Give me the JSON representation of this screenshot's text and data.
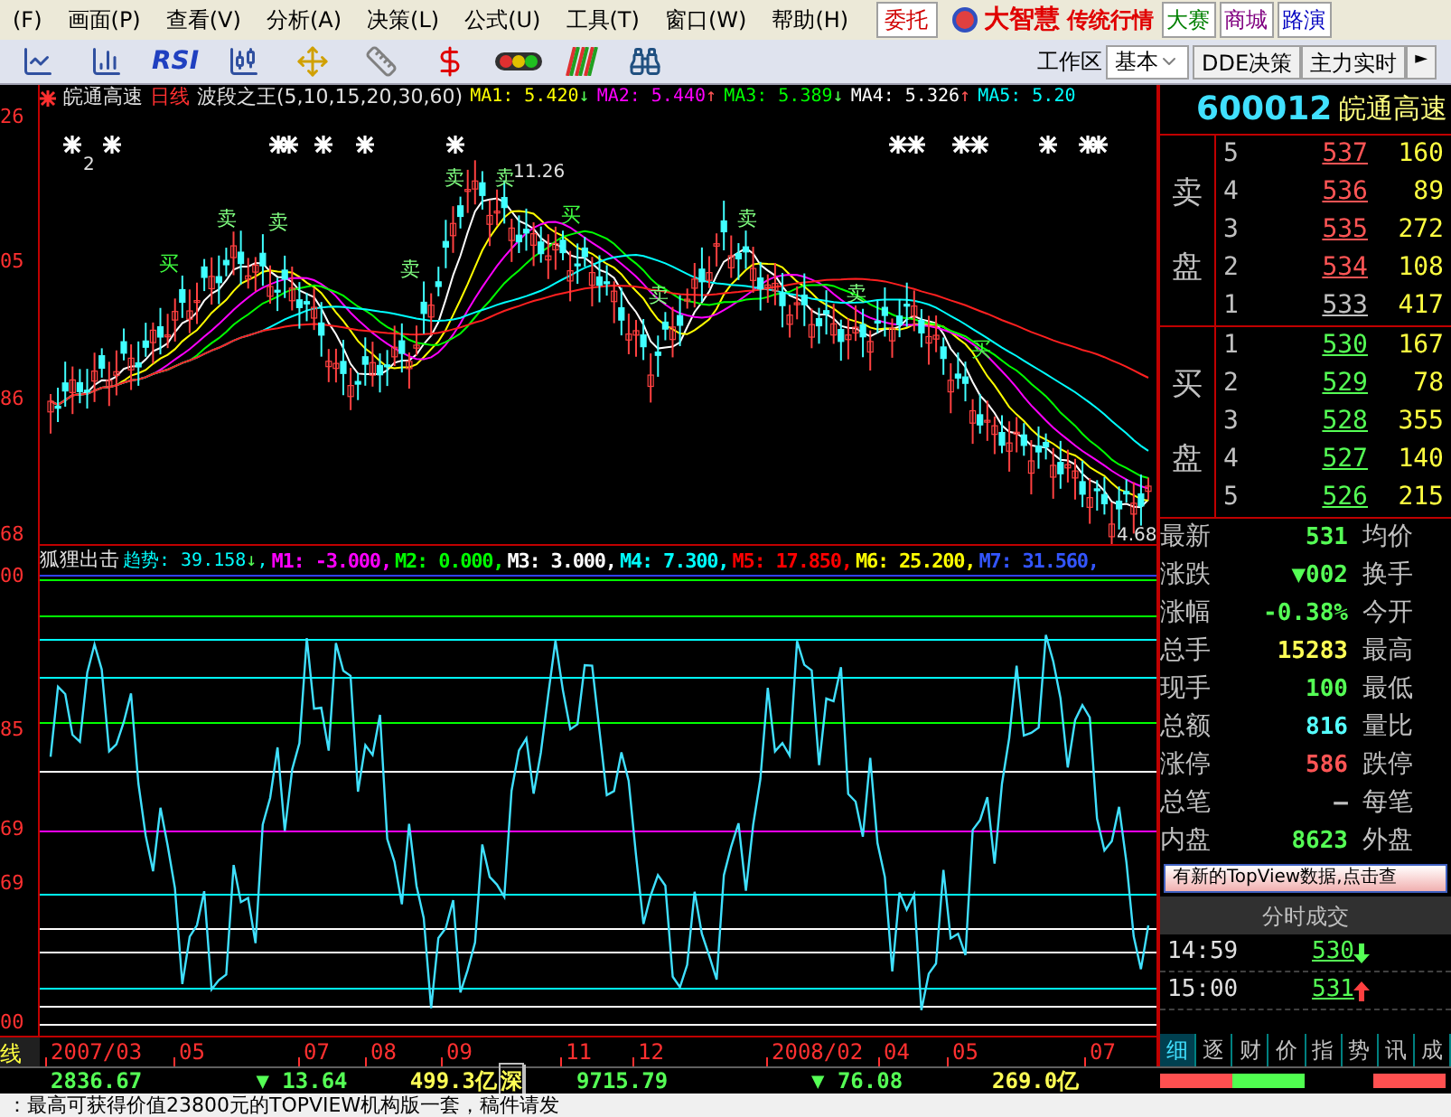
{
  "menu": [
    "(F)",
    "画面(P)",
    "查看(V)",
    "分析(A)",
    "决策(L)",
    "公式(U)",
    "工具(T)",
    "窗口(W)",
    "帮助(H)"
  ],
  "order_button": "委托",
  "brand": {
    "name": "大智慧",
    "subtitle": "传统行情"
  },
  "top_links": [
    "大赛",
    "商城",
    "路演"
  ],
  "toolbar": {
    "rsi": "RSI",
    "workspace_label": "工作区",
    "workspace_value": "基本",
    "tabs": [
      "DDE决策",
      "主力实时"
    ],
    "more": "►"
  },
  "upper_chart": {
    "stock": "皖通高速",
    "period": "日线",
    "indicator": "波段之王(5,10,15,20,30,60)",
    "mas": [
      {
        "label": "MA1: 5.420",
        "arrow": "↓",
        "rising": false,
        "color": "#ffff00"
      },
      {
        "label": "MA2: 5.440",
        "arrow": "↑",
        "rising": true,
        "color": "#ff00ff"
      },
      {
        "label": "MA3: 5.389",
        "arrow": "↓",
        "rising": false,
        "color": "#00ff00"
      },
      {
        "label": "MA4: 5.326",
        "arrow": "↑",
        "rising": true,
        "color": "#ffffff"
      },
      {
        "label": "MA5: 5.20",
        "color": "#00ffff"
      }
    ],
    "axis": [
      "26",
      "05",
      "86",
      "68"
    ],
    "annotations": [
      "11.26",
      "2",
      "4.68"
    ],
    "signals": [
      {
        "text": "买",
        "kind": "buy"
      },
      {
        "text": "卖",
        "kind": "sell"
      },
      {
        "text": "卖",
        "kind": "sell"
      },
      {
        "text": "卖",
        "kind": "sell"
      },
      {
        "text": "卖",
        "kind": "sell"
      },
      {
        "text": "卖",
        "kind": "sell"
      },
      {
        "text": "买",
        "kind": "buy"
      },
      {
        "text": "卖",
        "kind": "sell"
      },
      {
        "text": "卖",
        "kind": "sell"
      },
      {
        "text": "卖",
        "kind": "sell"
      },
      {
        "text": "买",
        "kind": "buy"
      }
    ]
  },
  "lower_chart": {
    "name": "狐狸出击",
    "trend": {
      "label": "趋势: 39.158",
      "arrow": "↓",
      "rising": false,
      "separator": ","
    },
    "lines": [
      {
        "label": "M1: -3.000,",
        "color": "#ff00ff"
      },
      {
        "label": "M2: 0.000,",
        "color": "#00ff00"
      },
      {
        "label": "M3: 3.000,",
        "color": "#ffffff"
      },
      {
        "label": "M4: 7.300,",
        "color": "#00ffff"
      },
      {
        "label": "M5: 17.850,",
        "color": "#ff0000"
      },
      {
        "label": "M6: 25.200,",
        "color": "#ffff00"
      },
      {
        "label": "M7: 31.560,",
        "color": "#3355ff"
      }
    ],
    "axis": [
      "00",
      "85",
      "69",
      "69",
      "00"
    ]
  },
  "time_axis": {
    "label": "线",
    "ticks": [
      "2007/03",
      "05",
      "07",
      "08",
      "09",
      "11",
      "12",
      "2008/02",
      "04",
      "05",
      "07"
    ]
  },
  "quote": {
    "code": "600012",
    "name": "皖通高速",
    "sell_label": "卖盘",
    "buy_label": "买盘",
    "sell": [
      {
        "rank": "5",
        "price": "537",
        "volume": "160",
        "color": "#ff5555"
      },
      {
        "rank": "4",
        "price": "536",
        "volume": "89",
        "color": "#ff5555"
      },
      {
        "rank": "3",
        "price": "535",
        "volume": "272",
        "color": "#ff5555"
      },
      {
        "rank": "2",
        "price": "534",
        "volume": "108",
        "color": "#ff5555"
      },
      {
        "rank": "1",
        "price": "533",
        "volume": "417",
        "color": "#c0c0c0"
      }
    ],
    "buy": [
      {
        "rank": "1",
        "price": "530",
        "volume": "167",
        "color": "#55ff55"
      },
      {
        "rank": "2",
        "price": "529",
        "volume": "78",
        "color": "#55ff55"
      },
      {
        "rank": "3",
        "price": "528",
        "volume": "355",
        "color": "#55ff55"
      },
      {
        "rank": "4",
        "price": "527",
        "volume": "140",
        "color": "#55ff55"
      },
      {
        "rank": "5",
        "price": "526",
        "volume": "215",
        "color": "#55ff55"
      }
    ],
    "stats": [
      {
        "label": "最新",
        "value": "531",
        "color": "#55ff55",
        "label2": "均价"
      },
      {
        "label": "涨跌",
        "value": "▼002",
        "color": "#55ff55",
        "label2": "换手"
      },
      {
        "label": "涨幅",
        "value": "-0.38%",
        "color": "#55ff55",
        "label2": "今开"
      },
      {
        "label": "总手",
        "value": "15283",
        "color": "#ffff55",
        "label2": "最高"
      },
      {
        "label": "现手",
        "value": "100",
        "color": "#55ff55",
        "label2": "最低"
      },
      {
        "label": "总额",
        "value": "816",
        "color": "#55ffff",
        "label2": "量比"
      },
      {
        "label": "涨停",
        "value": "586",
        "color": "#ff5555",
        "label2": "跌停"
      },
      {
        "label": "总笔",
        "value": "–",
        "color": "#c0c0c0",
        "label2": "每笔"
      },
      {
        "label": "内盘",
        "value": "8623",
        "color": "#55ff55",
        "label2": "外盘"
      }
    ],
    "notice": "有新的TopView数据,点击查",
    "trades_title": "分时成交",
    "trades": [
      {
        "time": "14:59",
        "price": "530",
        "rising": false
      },
      {
        "time": "15:00",
        "price": "531",
        "rising": true
      }
    ],
    "tabs": [
      {
        "label": "细",
        "selected": true
      },
      {
        "label": "逐",
        "selected": false
      },
      {
        "label": "财",
        "selected": false
      },
      {
        "label": "价",
        "selected": false
      },
      {
        "label": "指",
        "selected": false
      },
      {
        "label": "势",
        "selected": false
      },
      {
        "label": "讯",
        "selected": false
      },
      {
        "label": "成",
        "selected": false
      }
    ]
  },
  "status": {
    "indices": [
      {
        "value": "2836.67",
        "change": "▼ 13.64",
        "amount": "499.3亿"
      },
      {
        "value": "9715.79",
        "change": "▼ 76.08",
        "amount": "269.0亿"
      }
    ],
    "market_label": "深"
  },
  "ticker": "：最高可获得价值23800元的TOPVIEW机构版一套，稿件请发"
}
